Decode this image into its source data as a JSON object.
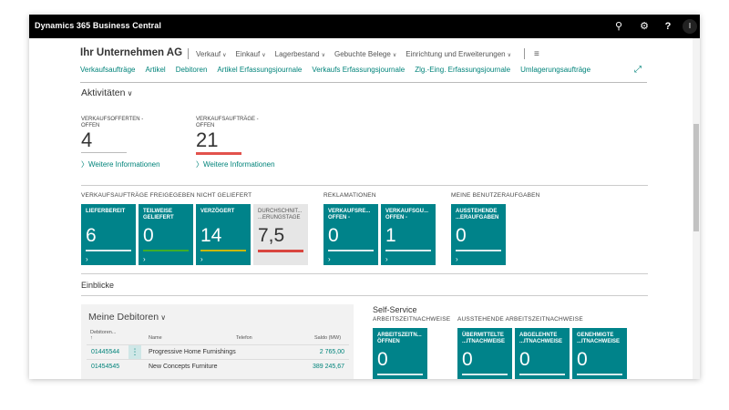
{
  "app": {
    "title": "Dynamics 365 Business Central",
    "avatar_initial": "I"
  },
  "header": {
    "company": "Ihr Unternehmen AG",
    "menu": [
      "Verkauf",
      "Einkauf",
      "Lagerbestand",
      "Gebuchte Belege",
      "Einrichtung und Erweiterungen"
    ],
    "links": [
      "Verkaufsaufträge",
      "Artikel",
      "Debitoren",
      "Artikel Erfassungsjournale",
      "Verkaufs Erfassungsjournale",
      "Zlg.-Eing. Erfassungsjournale",
      "Umlagerungsaufträge"
    ]
  },
  "activities": {
    "title": "Aktivitäten",
    "kpis": [
      {
        "label_line1": "VERKAUFSOFFERTEN -",
        "label_line2": "OFFEN",
        "value": "4",
        "more": "Weitere Informationen"
      },
      {
        "label_line1": "VERKAUFSAUFTRÄGE -",
        "label_line2": "OFFEN",
        "value": "21",
        "more": "Weitere Informationen"
      }
    ]
  },
  "groups": {
    "released": "VERKAUFSAUFTRÄGE FREIGEGEBEN NICHT GELIEFERT",
    "complaints": "REKLAMATIONEN",
    "usertasks": "MEINE BENUTZERAUFGABEN",
    "timesheets": "ARBEITSZEITNACHWEISE",
    "pending": "AUSSTEHENDE ARBEITSZEITNACHWEISE"
  },
  "tiles": [
    {
      "label": "LIEFERBEREIT",
      "value": "6"
    },
    {
      "label": "TEILWEISE GELIEFERT",
      "value": "0"
    },
    {
      "label": "VERZÖGERT",
      "value": "14"
    },
    {
      "label": "DURCHSCHNIT... ...ERUNGSTAGE",
      "value": "7,5"
    },
    {
      "label": "VERKAUFSRE... OFFEN -",
      "value": "0"
    },
    {
      "label": "VERKAUFSGU... OFFEN -",
      "value": "1"
    },
    {
      "label": "AUSSTEHENDE ...ERAUFGABEN",
      "value": "0"
    },
    {
      "label": "ARBEITSZEITN... ÖFFNEN",
      "value": "0"
    },
    {
      "label": "ÜBERMITTELTE ...ITNACHWEISE",
      "value": "0"
    },
    {
      "label": "ABGELEHNTE ...ITNACHWEISE",
      "value": "0"
    },
    {
      "label": "GENEHMIGTE ...ITNACHWEISE",
      "value": "0"
    }
  ],
  "insights": {
    "title": "Einblicke",
    "debitors": {
      "title": "Meine Debitoren",
      "columns": {
        "no": "Debitoren...",
        "sort": "↑",
        "name": "Name",
        "phone": "Telefon",
        "balance": "Saldo (MW)"
      },
      "rows": [
        {
          "no": "01445544",
          "name": "Progressive Home Furnishings",
          "balance": "2 765,00"
        },
        {
          "no": "01454545",
          "name": "New Concepts Furniture",
          "balance": "389 245,67"
        }
      ]
    },
    "selfservice": "Self-Service"
  }
}
